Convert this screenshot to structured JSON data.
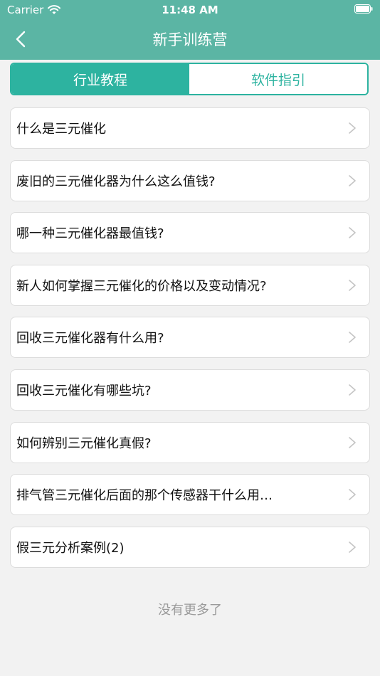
{
  "status_bar": {
    "carrier": "Carrier",
    "time": "11:48 AM",
    "wifi_icon": "wifi-icon",
    "battery_icon": "battery-icon"
  },
  "nav": {
    "title": "新手训练营",
    "back_icon": "chevron-left-icon"
  },
  "colors": {
    "header": "#5bb5a4",
    "accent": "#2db3a0",
    "background": "#f2f2f2"
  },
  "segment": {
    "tabs": [
      {
        "label": "行业教程",
        "selected": true
      },
      {
        "label": "软件指引",
        "selected": false
      }
    ]
  },
  "list": {
    "items": [
      {
        "label": "什么是三元催化"
      },
      {
        "label": "废旧的三元催化器为什么这么值钱?"
      },
      {
        "label": "哪一种三元催化器最值钱?"
      },
      {
        "label": "新人如何掌握三元催化的价格以及变动情况?"
      },
      {
        "label": "回收三元催化器有什么用?"
      },
      {
        "label": "回收三元催化有哪些坑?"
      },
      {
        "label": "如何辨别三元催化真假?"
      },
      {
        "label": "排气管三元催化后面的那个传感器干什么用…"
      },
      {
        "label": "假三元分析案例(2)"
      }
    ],
    "item_icon": "chevron-right-icon"
  },
  "footer": {
    "text": "没有更多了"
  }
}
